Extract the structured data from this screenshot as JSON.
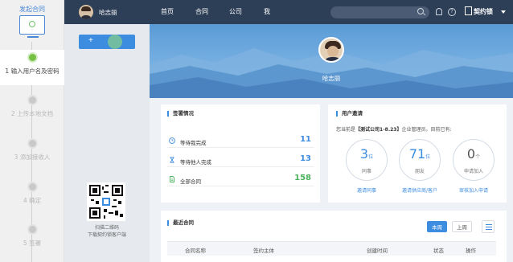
{
  "wizard": {
    "title": "发起合同",
    "steps": [
      {
        "label": "1 输入用户名及密码",
        "active": true
      },
      {
        "label": "2 上传本地文档",
        "active": false
      },
      {
        "label": "3 添加接收人",
        "active": false
      },
      {
        "label": "4 确定",
        "active": false
      },
      {
        "label": "5 签署",
        "active": false
      }
    ]
  },
  "sidebar": {
    "new_button_plus": "+",
    "qr_caption_line1": "扫描二维码",
    "qr_caption_line2": "下载契约锁客户端"
  },
  "topbar": {
    "user_name": "哈志丽",
    "nav": [
      "首页",
      "合同",
      "公司",
      "我"
    ],
    "search_value": "",
    "logo_text": "契约锁"
  },
  "banner": {
    "user_name": "哈志丽"
  },
  "signing": {
    "title": "签署情况",
    "rows": [
      {
        "label": "等待我完成",
        "value": "11"
      },
      {
        "label": "等待他人完成",
        "value": "13"
      },
      {
        "label": "全部合同",
        "value": "158"
      }
    ]
  },
  "invite": {
    "title": "用户邀请",
    "desc_prefix": "您当前是",
    "company": "【测试公司1-8.23】",
    "desc_suffix": "企业管理员。目前已有:",
    "stats": [
      {
        "value": "3",
        "unit": "位",
        "caption": "同事",
        "link": "邀请同事"
      },
      {
        "value": "71",
        "unit": "位",
        "caption": "朋友",
        "link": "邀请供应商/客户"
      },
      {
        "value": "0",
        "unit": "个",
        "caption": "申请加入",
        "link": "审核加入申请"
      }
    ]
  },
  "recent": {
    "title": "最近合同",
    "btn_week": "本周",
    "btn_month": "上周",
    "columns": [
      "合同名称",
      "签约主体",
      "创建时间",
      "状态",
      "操作"
    ]
  },
  "colors": {
    "accent": "#3c8ce0",
    "topbar": "#2d3e57",
    "green": "#76c043"
  }
}
